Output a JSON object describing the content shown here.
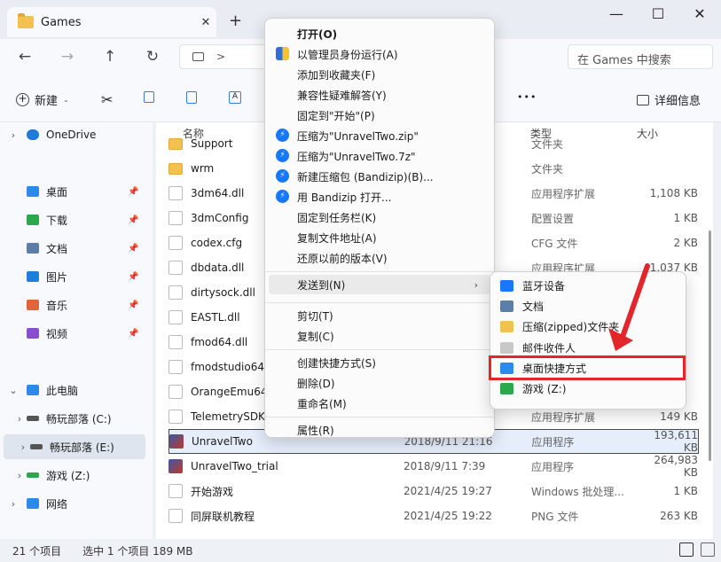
{
  "window": {
    "tab_title": "Games",
    "new_tab": "+"
  },
  "controls": {
    "minimize": "—",
    "maximize": "☐",
    "close": "✕"
  },
  "nav": {
    "back": "←",
    "forward": "→",
    "up": "↑",
    "refresh": "↻",
    "crumb_sep": ">",
    "search_placeholder": "在 Games 中搜索"
  },
  "toolbar": {
    "new_label": "新建",
    "more": "•••",
    "details_label": "详细信息"
  },
  "sidebar": {
    "onedrive": "OneDrive",
    "quick": [
      {
        "label": "桌面",
        "color": "#2c8be8"
      },
      {
        "label": "下载",
        "color": "#2aa84a"
      },
      {
        "label": "文档",
        "color": "#5b7fa8"
      },
      {
        "label": "图片",
        "color": "#1e80d8"
      },
      {
        "label": "音乐",
        "color": "#e0653a"
      },
      {
        "label": "视频",
        "color": "#8a4fd0"
      }
    ],
    "thispc": "此电脑",
    "drives": [
      {
        "label": "畅玩部落 (C:)"
      },
      {
        "label": "畅玩部落 (E:)"
      },
      {
        "label": "游戏 (Z:)"
      }
    ],
    "network": "网络"
  },
  "columns": {
    "name": "名称",
    "type": "类型",
    "size": "大小"
  },
  "files": [
    {
      "name": "Support",
      "date": "",
      "type": "文件夹",
      "size": "",
      "kind": "folder"
    },
    {
      "name": "wrm",
      "date": "",
      "type": "文件夹",
      "size": "",
      "kind": "folder"
    },
    {
      "name": "3dm64.dll",
      "date": "",
      "type": "应用程序扩展",
      "size": "1,108 KB",
      "kind": "file"
    },
    {
      "name": "3dmConfig",
      "date": "",
      "type": "配置设置",
      "size": "1 KB",
      "kind": "file"
    },
    {
      "name": "codex.cfg",
      "date": "",
      "type": "CFG 文件",
      "size": "2 KB",
      "kind": "file"
    },
    {
      "name": "dbdata.dll",
      "date": "",
      "type": "应用程序扩展",
      "size": "1,037 KB",
      "kind": "file"
    },
    {
      "name": "dirtysock.dll",
      "date": "",
      "type": "",
      "size": "",
      "kind": "file"
    },
    {
      "name": "EASTL.dll",
      "date": "",
      "type": "",
      "size": "",
      "kind": "file"
    },
    {
      "name": "fmod64.dll",
      "date": "",
      "type": "",
      "size": "",
      "kind": "file"
    },
    {
      "name": "fmodstudio64.",
      "date": "",
      "type": "",
      "size": "",
      "kind": "file"
    },
    {
      "name": "OrangeEmu64",
      "date": "",
      "type": "",
      "size": "",
      "kind": "file"
    },
    {
      "name": "TelemetrySDK.",
      "date": "",
      "type": "应用程序扩展",
      "size": "149 KB",
      "kind": "file"
    },
    {
      "name": "UnravelTwo",
      "date": "2018/9/11 21:16",
      "type": "应用程序",
      "size": "193,611 KB",
      "kind": "app"
    },
    {
      "name": "UnravelTwo_trial",
      "date": "2018/9/11 7:39",
      "type": "应用程序",
      "size": "264,983 KB",
      "kind": "app"
    },
    {
      "name": "开始游戏",
      "date": "2021/4/25 19:27",
      "type": "Windows 批处理...",
      "size": "1 KB",
      "kind": "file"
    },
    {
      "name": "同屏联机教程",
      "date": "2021/4/25 19:22",
      "type": "PNG 文件",
      "size": "263 KB",
      "kind": "file"
    }
  ],
  "menu": {
    "items": [
      {
        "label": "打开(O)",
        "icon": "",
        "bold": true
      },
      {
        "label": "以管理员身份运行(A)",
        "icon": "shield"
      },
      {
        "label": "添加到收藏夹(F)",
        "icon": ""
      },
      {
        "label": "兼容性疑难解答(Y)",
        "icon": ""
      },
      {
        "label": "固定到\"开始\"(P)",
        "icon": ""
      },
      {
        "label": "压缩为\"UnravelTwo.zip\"",
        "icon": "bandizip"
      },
      {
        "label": "压缩为\"UnravelTwo.7z\"",
        "icon": "bandizip"
      },
      {
        "label": "新建压缩包 (Bandizip)(B)...",
        "icon": "bandizip"
      },
      {
        "label": "用 Bandizip 打开...",
        "icon": "bandizip"
      },
      {
        "label": "固定到任务栏(K)",
        "icon": ""
      },
      {
        "label": "复制文件地址(A)",
        "icon": ""
      },
      {
        "label": "还原以前的版本(V)",
        "icon": ""
      },
      {
        "label": "发送到(N)",
        "icon": "",
        "sub": true
      },
      {
        "label": "剪切(T)",
        "icon": ""
      },
      {
        "label": "复制(C)",
        "icon": ""
      },
      {
        "label": "创建快捷方式(S)",
        "icon": ""
      },
      {
        "label": "删除(D)",
        "icon": ""
      },
      {
        "label": "重命名(M)",
        "icon": ""
      },
      {
        "label": "属性(R)",
        "icon": ""
      }
    ]
  },
  "submenu": {
    "items": [
      {
        "label": "蓝牙设备",
        "color": "#1677ff"
      },
      {
        "label": "文档",
        "color": "#5b7fa8"
      },
      {
        "label": "压缩(zipped)文件夹",
        "color": "#f2c14e"
      },
      {
        "label": "邮件收件人",
        "color": "#c8c8c8"
      },
      {
        "label": "桌面快捷方式",
        "color": "#2c8be8"
      },
      {
        "label": "游戏 (Z:)",
        "color": "#2aa84a"
      }
    ]
  },
  "status": {
    "count": "21 个项目",
    "selected": "选中 1 个项目  189 MB"
  },
  "colors": {
    "highlight": "#e3262b",
    "selection_bg": "#e6eefc"
  }
}
